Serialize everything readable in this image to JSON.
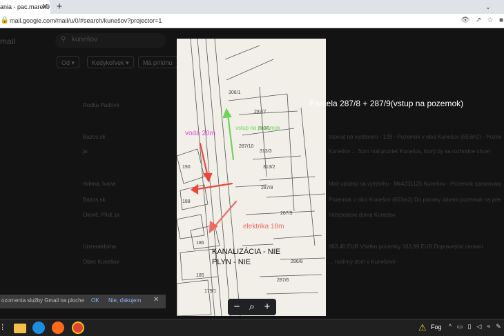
{
  "browser": {
    "tab_title": "ania - pac.marek9",
    "tab_close": "✕",
    "new_tab": "+",
    "tab_menu": "⌄",
    "url": "mail.google.com/mail/u/0/#search/kunešov?projector=1"
  },
  "gmail": {
    "logo": "mail",
    "search_value": "kunešov",
    "chips": [
      "Od",
      "Kedykoľvek",
      "Má prílohu"
    ],
    "rows": [
      {
        "sender": "Rodka Paďová",
        "snippet": ""
      },
      {
        "sender": "Bazos.sk",
        "snippet": "Inzerát na vystavení - 128 - Pozemok v obci Kunešov (653m2) - Pozemok"
      },
      {
        "sender": "ja",
        "snippet": "Kunešov ... Som mal pozrieť Kunešov, ktorý by sa rozhodne chcel"
      },
      {
        "sender": "milena, Ivana",
        "snippet": "Mail uplatný na vyzdvihu - Mk4231125 Kunešov - Pozemok spracovaný"
      },
      {
        "sender": "Bazos.sk",
        "snippet": "Pozemok v obci Kunešov (653m2) Do ponuky dávam pozemok na predaj"
      },
      {
        "sender": "Olovič, Pilot, ja",
        "snippet": "Interpelácie doma Kunešov"
      },
      {
        "sender": "Unzeratdoma",
        "snippet": "863,40 EUR Všetko pozemky 163,99 EUR Dopravnými cenami"
      },
      {
        "sender": "Obec Kunešov",
        "snippet": "... rodinný dom v Kunešove"
      }
    ]
  },
  "viewer": {
    "parcela": "Parcela  287/8 + 287/9(vstup na pozemok)",
    "voda": "voda 20m",
    "green_note": "vstup na pozemok",
    "elektrika": "elektrika 18m",
    "kanalizacia": "KANALIZÁCIA - NIE",
    "plyn": "PLYN - NIE",
    "parcel_numbers": [
      "306/1",
      "287/7",
      "313/1",
      "287/10",
      "313/3",
      "313/2",
      "287/8",
      "287/9",
      "190",
      "188",
      "186",
      "185",
      "179/1",
      "287/6",
      "286/8"
    ],
    "zoom_out": "−",
    "zoom_icon": "⌕",
    "zoom_in": "+"
  },
  "notification": {
    "text": "ozornenia služby Gmail na ploche",
    "ok": "OK",
    "no": "Nie, ďakujem",
    "close": "✕"
  },
  "taskbar": {
    "weather": "Fog"
  },
  "colors": {
    "pink": "#d64fd1",
    "red": "#f0443a",
    "green": "#6fd35a",
    "salmon": "#ef6b61"
  }
}
